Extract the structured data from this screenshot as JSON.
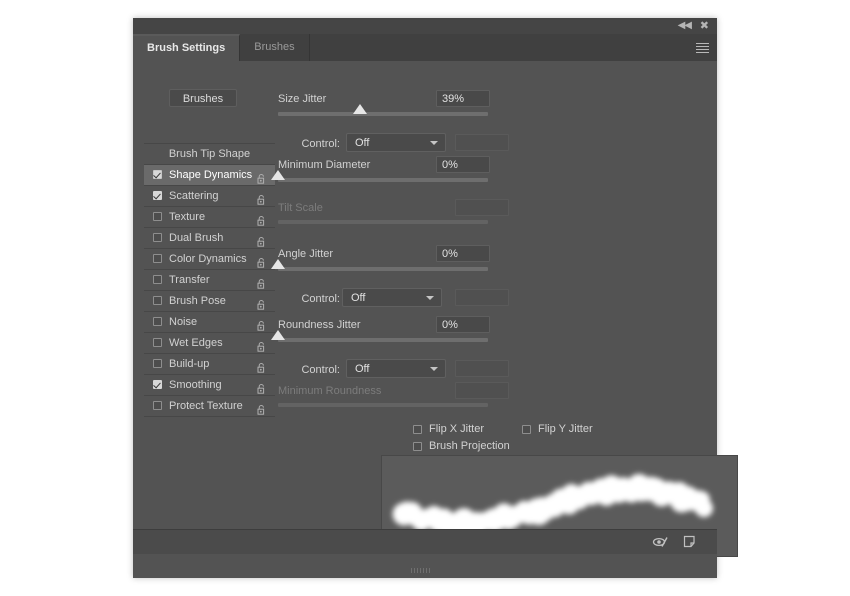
{
  "window": {
    "collapse_icon": "collapse-arrows-icon",
    "close_icon": "close-icon",
    "collapse_glyph": "◀◀",
    "close_glyph": "✖",
    "menu_icon": "panel-menu-icon"
  },
  "tabs": [
    {
      "label": "Brush Settings",
      "active": true
    },
    {
      "label": "Brushes",
      "active": false
    }
  ],
  "sidebar": {
    "brushes_button": "Brushes",
    "header": "Brush Tip Shape",
    "items": [
      {
        "label": "Shape Dynamics",
        "checked": true,
        "selected": true,
        "lock": "unlocked-padlock-icon"
      },
      {
        "label": "Scattering",
        "checked": true,
        "selected": false,
        "lock": "unlocked-padlock-icon"
      },
      {
        "label": "Texture",
        "checked": false,
        "selected": false,
        "lock": "unlocked-padlock-icon"
      },
      {
        "label": "Dual Brush",
        "checked": false,
        "selected": false,
        "lock": "unlocked-padlock-icon"
      },
      {
        "label": "Color Dynamics",
        "checked": false,
        "selected": false,
        "lock": "unlocked-padlock-icon"
      },
      {
        "label": "Transfer",
        "checked": false,
        "selected": false,
        "lock": "unlocked-padlock-icon"
      },
      {
        "label": "Brush Pose",
        "checked": false,
        "selected": false,
        "lock": "unlocked-padlock-icon"
      },
      {
        "label": "Noise",
        "checked": false,
        "selected": false,
        "lock": "unlocked-padlock-icon"
      },
      {
        "label": "Wet Edges",
        "checked": false,
        "selected": false,
        "lock": "unlocked-padlock-icon"
      },
      {
        "label": "Build-up",
        "checked": false,
        "selected": false,
        "lock": "unlocked-padlock-icon"
      },
      {
        "label": "Smoothing",
        "checked": true,
        "selected": false,
        "lock": "unlocked-padlock-icon"
      },
      {
        "label": "Protect Texture",
        "checked": false,
        "selected": false,
        "lock": "unlocked-padlock-icon"
      }
    ]
  },
  "controls": {
    "size_jitter": {
      "label": "Size Jitter",
      "value": "39%",
      "slider_percent": 39
    },
    "size_jitter_control": {
      "label": "Control:",
      "value": "Off",
      "extra_value": ""
    },
    "minimum_diameter": {
      "label": "Minimum Diameter",
      "value": "0%",
      "slider_percent": 0
    },
    "tilt_scale": {
      "label": "Tilt Scale",
      "value": "",
      "slider_percent": 0,
      "disabled": true
    },
    "angle_jitter": {
      "label": "Angle Jitter",
      "value": "0%",
      "slider_percent": 0
    },
    "angle_jitter_control": {
      "label": "Control:",
      "value": "Off",
      "extra_value": ""
    },
    "roundness_jitter": {
      "label": "Roundness Jitter",
      "value": "0%",
      "slider_percent": 0
    },
    "roundness_jitter_control": {
      "label": "Control:",
      "value": "Off",
      "extra_value": ""
    },
    "minimum_roundness": {
      "label": "Minimum Roundness",
      "value": "",
      "slider_percent": 0,
      "disabled": true
    },
    "checkboxes": [
      {
        "label": "Flip X Jitter",
        "checked": false
      },
      {
        "label": "Flip Y Jitter",
        "checked": false
      },
      {
        "label": "Brush Projection",
        "checked": false
      }
    ]
  },
  "preview": {
    "name": "brush-stroke-preview"
  },
  "footer": {
    "toggle_preview_icon": "eye-slash-icon",
    "new_brush_icon": "new-brush-preset-icon"
  },
  "colors": {
    "panel_bg": "#535353",
    "tabstrip_bg": "#404040",
    "titlebar_bg": "#454545",
    "footer_bg": "#4b4b4b",
    "selected_row": "#6a6a6a",
    "text": "#d2d2d2",
    "text_disabled": "#7c7c7c",
    "field_bg": "#494949",
    "slider_track": "#6e6e6e",
    "thumb": "#e6e6e6",
    "stroke_white": "#ffffff"
  }
}
